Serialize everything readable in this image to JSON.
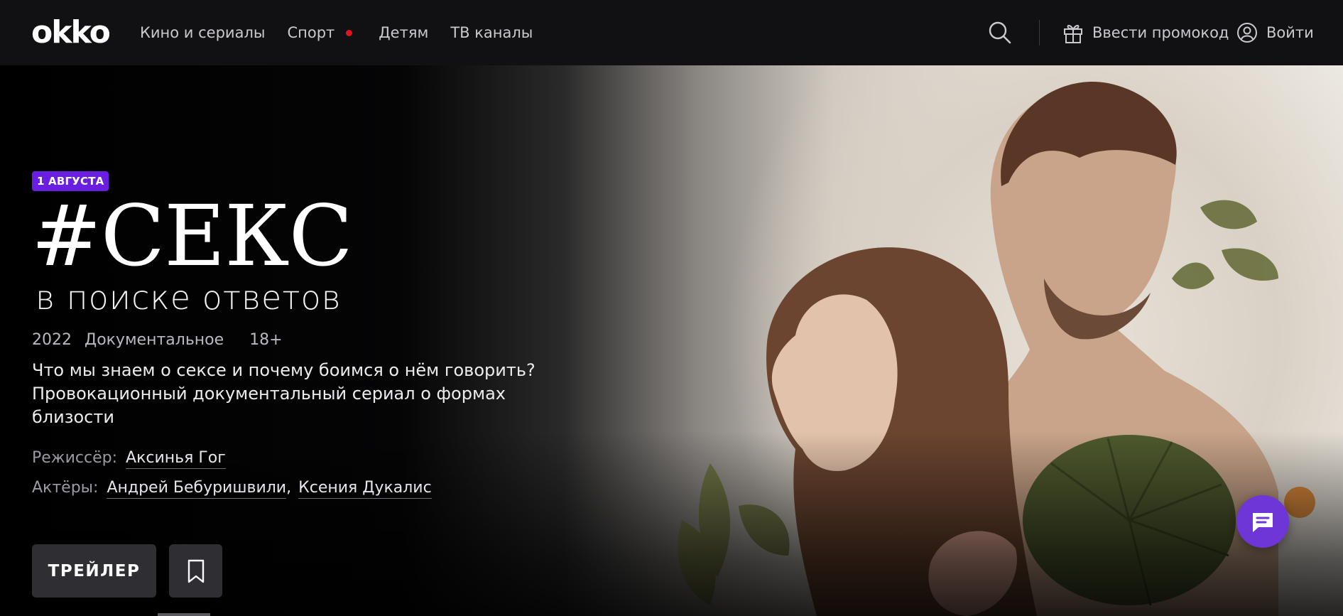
{
  "header": {
    "logo_text": "okko",
    "nav": [
      {
        "label": "Кино и сериалы"
      },
      {
        "label": "Спорт",
        "live": true
      },
      {
        "label": "Детям"
      },
      {
        "label": "ТВ каналы"
      }
    ],
    "search_icon": "search-icon",
    "promo_label": "Ввести промокод",
    "promo_icon": "gift-icon",
    "login_label": "Войти",
    "login_icon": "user-icon",
    "live_color": "#e0141e"
  },
  "hero": {
    "badge": "1 АВГУСТА",
    "badge_color": "#6a1ee0",
    "title": "#СЕКС",
    "subtitle": "в поиске ответов",
    "year": "2022",
    "genre": "Документальное",
    "age": "18+",
    "description": "Что мы знаем о сексе и почему боимся о нём говорить? Провокационный документальный сериал о формах близости",
    "director_label": "Режиссёр:",
    "director": "Аксинья Гог",
    "actors_label": "Актёры:",
    "actors": [
      "Андрей Бебуришвили",
      "Ксения Дукалис"
    ],
    "trailer_label": "ТРЕЙЛЕР",
    "bookmark_icon": "bookmark-icon",
    "chat_icon": "chat-icon",
    "chat_color": "#6e36d6"
  }
}
